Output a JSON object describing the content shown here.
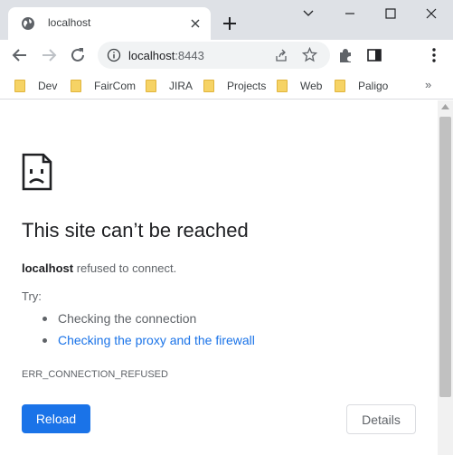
{
  "tab": {
    "title": "localhost",
    "favicon": "globe-icon"
  },
  "omnibox": {
    "host": "localhost",
    "port": ":8443"
  },
  "bookmarks": [
    {
      "label": "Dev"
    },
    {
      "label": "FairCom"
    },
    {
      "label": "JIRA"
    },
    {
      "label": "Projects"
    },
    {
      "label": "Web"
    },
    {
      "label": "Paligo"
    }
  ],
  "bookmarks_more": "»",
  "error": {
    "title": "This site can’t be reached",
    "host": "localhost",
    "description_suffix": " refused to connect.",
    "try_label": "Try:",
    "suggestions": [
      {
        "text": "Checking the connection"
      },
      {
        "text": "Checking the proxy and the firewall"
      }
    ],
    "code": "ERR_CONNECTION_REFUSED"
  },
  "buttons": {
    "reload": "Reload",
    "details": "Details"
  },
  "colors": {
    "accent": "#1a73e8",
    "tabstrip": "#dee1e6",
    "folder": "#f6d365"
  }
}
